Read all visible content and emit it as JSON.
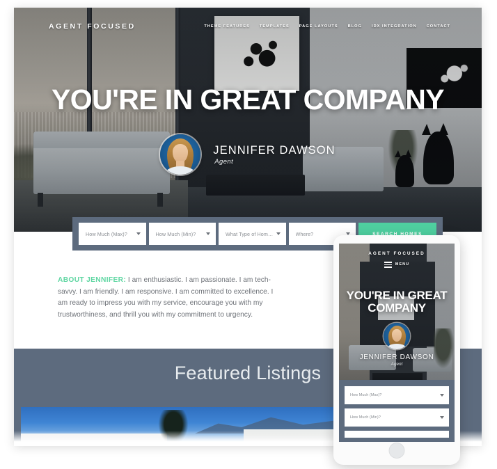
{
  "site": {
    "brand": "AGENT FOCUSED",
    "nav": [
      {
        "label": "THEME FEATURES"
      },
      {
        "label": "TEMPLATES"
      },
      {
        "label": "PAGE LAYOUTS"
      },
      {
        "label": "BLOG"
      },
      {
        "label": "IDX INTEGRATION"
      },
      {
        "label": "CONTACT"
      }
    ]
  },
  "hero": {
    "title": "YOU'RE IN GREAT COMPANY",
    "agent_name": "JENNIFER DAWSON",
    "agent_role": "Agent",
    "avatar_icon": "agent-portrait-avatar"
  },
  "search": {
    "fields": [
      {
        "placeholder": "How Much (Max)?",
        "value": "How Much (Max)?",
        "caret_icon": "chevron-down-icon"
      },
      {
        "placeholder": "How Much (Min)?",
        "value": "How Much (Min)?",
        "caret_icon": "chevron-down-icon"
      },
      {
        "placeholder": "What Type of Home?",
        "value": "What Type of Home?",
        "caret_icon": "chevron-down-icon"
      },
      {
        "placeholder": "Where?",
        "value": "Where?",
        "caret_icon": "chevron-down-icon"
      }
    ],
    "button_label": "SEARCH HOMES"
  },
  "about": {
    "lead": "ABOUT JENNIFER:",
    "body": " I am enthusiastic. I am passionate. I am tech-savvy. I am friendly. I am responsive. I am committed to excellence. I am ready to impress you with my service, encourage you with my trustworthiness, and thrill you with my commitment to urgency."
  },
  "featured": {
    "heading": "Featured Listings"
  },
  "mobile": {
    "brand": "AGENT FOCUSED",
    "menu_label": "MENU",
    "menu_icon": "hamburger-menu-icon",
    "title": "YOU'RE IN GREAT COMPANY",
    "agent_name": "JENNIFER DAWSON",
    "agent_role": "Agent",
    "fields": [
      {
        "placeholder": "How Much (Max)?",
        "value": "How Much (Max)?",
        "caret_icon": "chevron-down-icon"
      },
      {
        "placeholder": "How Much (Min)?",
        "value": "How Much (Min)?",
        "caret_icon": "chevron-down-icon"
      }
    ],
    "home_button_icon": "home-button-icon"
  },
  "colors": {
    "accent_green": "#4fd0a0",
    "lead_green": "#5fd6a2",
    "slate": "#5d6b7e",
    "body_text": "#6e7278"
  }
}
